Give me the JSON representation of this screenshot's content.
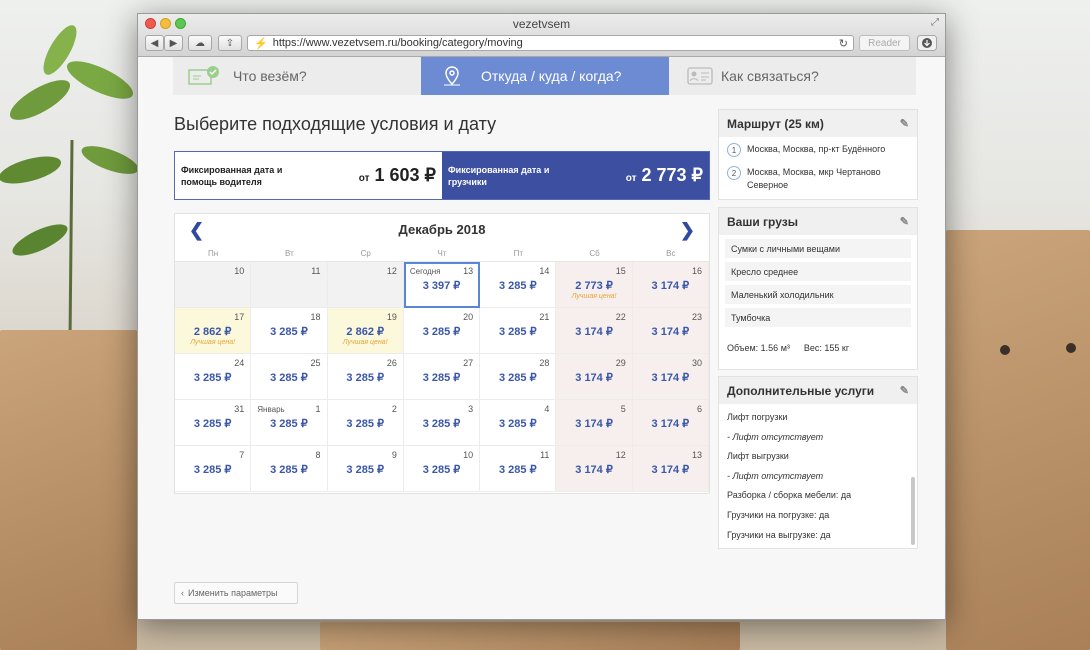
{
  "browser": {
    "title": "vezetvsem",
    "url": "https://www.vezetvsem.ru/booking/category/moving",
    "reader_label": "Reader"
  },
  "steps": [
    {
      "label": "Что везём?",
      "icon": "truck-check-icon"
    },
    {
      "label": "Откуда / куда / когда?",
      "icon": "map-pin-icon"
    },
    {
      "label": "Как связаться?",
      "icon": "contact-card-icon"
    }
  ],
  "heading": "Выберите подходящие условия и дату",
  "tariffs": [
    {
      "name": "Фиксированная дата и помощь водителя",
      "from": "от",
      "price": "1 603 ₽",
      "selected": false
    },
    {
      "name": "Фиксированная дата и грузчики",
      "from": "от",
      "price": "2 773 ₽",
      "selected": true
    }
  ],
  "calendar": {
    "month": "Декабрь 2018",
    "weekdays": [
      "Пн",
      "Вт",
      "Ср",
      "Чт",
      "Пт",
      "Сб",
      "Вс"
    ],
    "best_label": "Лучшая цена!",
    "today_label": "Сегодня",
    "january_label": "Январь",
    "cells": [
      {
        "d": "10",
        "p": "",
        "t": "past"
      },
      {
        "d": "11",
        "p": "",
        "t": "past"
      },
      {
        "d": "12",
        "p": "",
        "t": "past"
      },
      {
        "d": "13",
        "p": "3 397 ₽",
        "t": "today",
        "lbl": "Сегодня"
      },
      {
        "d": "14",
        "p": "3 285 ₽",
        "t": ""
      },
      {
        "d": "15",
        "p": "2 773 ₽",
        "t": "weekend",
        "best": true
      },
      {
        "d": "16",
        "p": "3 174 ₽",
        "t": "weekend"
      },
      {
        "d": "17",
        "p": "2 862 ₽",
        "t": "best",
        "best": true
      },
      {
        "d": "18",
        "p": "3 285 ₽",
        "t": ""
      },
      {
        "d": "19",
        "p": "2 862 ₽",
        "t": "best",
        "best": true
      },
      {
        "d": "20",
        "p": "3 285 ₽",
        "t": ""
      },
      {
        "d": "21",
        "p": "3 285 ₽",
        "t": ""
      },
      {
        "d": "22",
        "p": "3 174 ₽",
        "t": "weekend"
      },
      {
        "d": "23",
        "p": "3 174 ₽",
        "t": "weekend"
      },
      {
        "d": "24",
        "p": "3 285 ₽",
        "t": ""
      },
      {
        "d": "25",
        "p": "3 285 ₽",
        "t": ""
      },
      {
        "d": "26",
        "p": "3 285 ₽",
        "t": ""
      },
      {
        "d": "27",
        "p": "3 285 ₽",
        "t": ""
      },
      {
        "d": "28",
        "p": "3 285 ₽",
        "t": ""
      },
      {
        "d": "29",
        "p": "3 174 ₽",
        "t": "weekend"
      },
      {
        "d": "30",
        "p": "3 174 ₽",
        "t": "weekend"
      },
      {
        "d": "31",
        "p": "3 285 ₽",
        "t": ""
      },
      {
        "d": "1",
        "p": "3 285 ₽",
        "t": "",
        "lbl": "Январь"
      },
      {
        "d": "2",
        "p": "3 285 ₽",
        "t": ""
      },
      {
        "d": "3",
        "p": "3 285 ₽",
        "t": ""
      },
      {
        "d": "4",
        "p": "3 285 ₽",
        "t": ""
      },
      {
        "d": "5",
        "p": "3 174 ₽",
        "t": "weekend"
      },
      {
        "d": "6",
        "p": "3 174 ₽",
        "t": "weekend"
      },
      {
        "d": "7",
        "p": "3 285 ₽",
        "t": ""
      },
      {
        "d": "8",
        "p": "3 285 ₽",
        "t": ""
      },
      {
        "d": "9",
        "p": "3 285 ₽",
        "t": ""
      },
      {
        "d": "10",
        "p": "3 285 ₽",
        "t": ""
      },
      {
        "d": "11",
        "p": "3 285 ₽",
        "t": ""
      },
      {
        "d": "12",
        "p": "3 174 ₽",
        "t": "weekend"
      },
      {
        "d": "13",
        "p": "3 174 ₽",
        "t": "weekend"
      }
    ]
  },
  "change_button": "Изменить параметры",
  "route": {
    "title": "Маршрут (25 км)",
    "points": [
      {
        "n": "1",
        "text": "Москва, Москва, пр-кт Будённого"
      },
      {
        "n": "2",
        "text": "Москва, Москва, мкр Чертаново Северное"
      }
    ]
  },
  "cargo": {
    "title": "Ваши грузы",
    "items": [
      "Сумки с личными вещами",
      "Кресло среднее",
      "Маленький холодильник",
      "Тумбочка"
    ],
    "volume": "Объем: 1.56 м³",
    "weight": "Вес: 155 кг"
  },
  "services": {
    "title": "Дополнительные услуги",
    "items": [
      {
        "text": "Лифт погрузки",
        "italic": false
      },
      {
        "text": "- Лифт отсутствует",
        "italic": true
      },
      {
        "text": "Лифт выгрузки",
        "italic": false
      },
      {
        "text": "- Лифт отсутствует",
        "italic": true
      },
      {
        "text": "Разборка / сборка мебели: да",
        "italic": false
      },
      {
        "text": "Грузчики на погрузке: да",
        "italic": false
      },
      {
        "text": "Грузчики на выгрузке: да",
        "italic": false
      }
    ]
  },
  "colors": {
    "accent": "#3d4fa0",
    "step_active": "#6d8bd2",
    "best": "#e8a433"
  }
}
